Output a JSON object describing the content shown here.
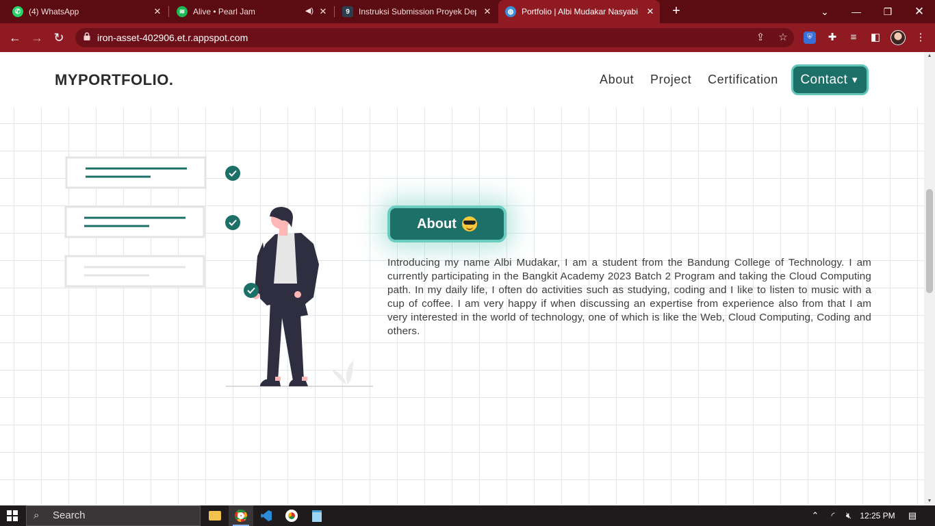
{
  "browser": {
    "tabs": [
      {
        "title": "(4) WhatsApp",
        "icon": "whatsapp-icon",
        "color": "#25d366"
      },
      {
        "title": "Alive • Pearl Jam",
        "icon": "spotify-icon",
        "color": "#1db954",
        "audio_icon": "speaker-icon"
      },
      {
        "title": "Instruksi Submission Proyek Dep",
        "icon": "dicoding-icon",
        "color": "#2d3e50"
      },
      {
        "title": "Portfolio | Albi Mudakar Nasyabi",
        "icon": "globe-icon",
        "color": "#3b8fd6"
      }
    ],
    "url": "iron-asset-402906.et.r.appspot.com"
  },
  "page": {
    "brand": "MYPORTFOLIO.",
    "nav": {
      "about": "About",
      "project": "Project",
      "certification": "Certification",
      "contact": "Contact"
    },
    "about_button": "About",
    "about_text": "Introducing my name Albi Mudakar, I am a student from the Bandung College of Technology. I am currently participating in the Bangkit Academy 2023 Batch 2 Program and taking the Cloud Computing path. In my daily life, I often do activities such as studying, coding and I like to listen to music with a cup of coffee. I am very happy if when discussing an expertise from experience also from that I am very interested in the world of technology, one of which is like the Web, Cloud Computing, Coding and others.",
    "accent_color": "#1d7068"
  },
  "taskbar": {
    "search_placeholder": "Search",
    "time": "12:25 PM"
  }
}
